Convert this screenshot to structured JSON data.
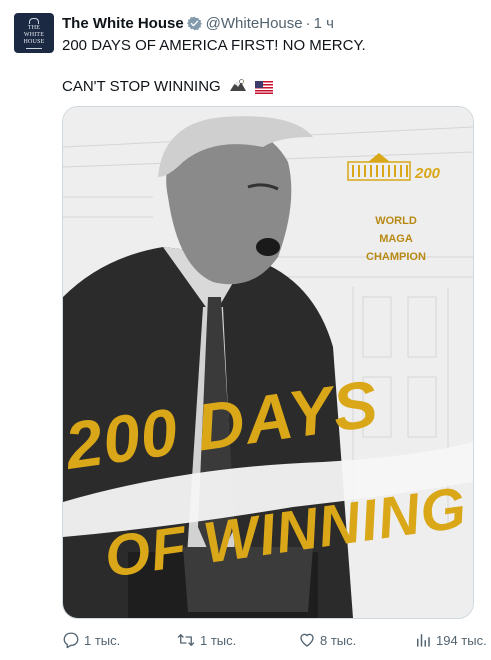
{
  "author": {
    "avatar_text": [
      "THE",
      "WHITE",
      "HOUSE"
    ],
    "name": "The White House",
    "handle": "@WhiteHouse",
    "separator": "·",
    "time": "1 ч"
  },
  "tweet": {
    "line1": "200 DAYS OF AMERICA FIRST! NO MERCY.",
    "line2": "CAN'T STOP WINNING",
    "emojis": [
      "eagle-emoji",
      "us-flag-emoji"
    ]
  },
  "media": {
    "logo_number": "200",
    "badge_lines": [
      "WORLD",
      "MAGA",
      "CHAMPION"
    ],
    "headline_top": "200 DAYS",
    "headline_bottom": "OF WINNING",
    "accent_color": "#d9a718"
  },
  "actions": {
    "replies": "1 тыс.",
    "retweets": "1 тыс.",
    "likes": "8 тыс.",
    "views": "194 тыс."
  }
}
